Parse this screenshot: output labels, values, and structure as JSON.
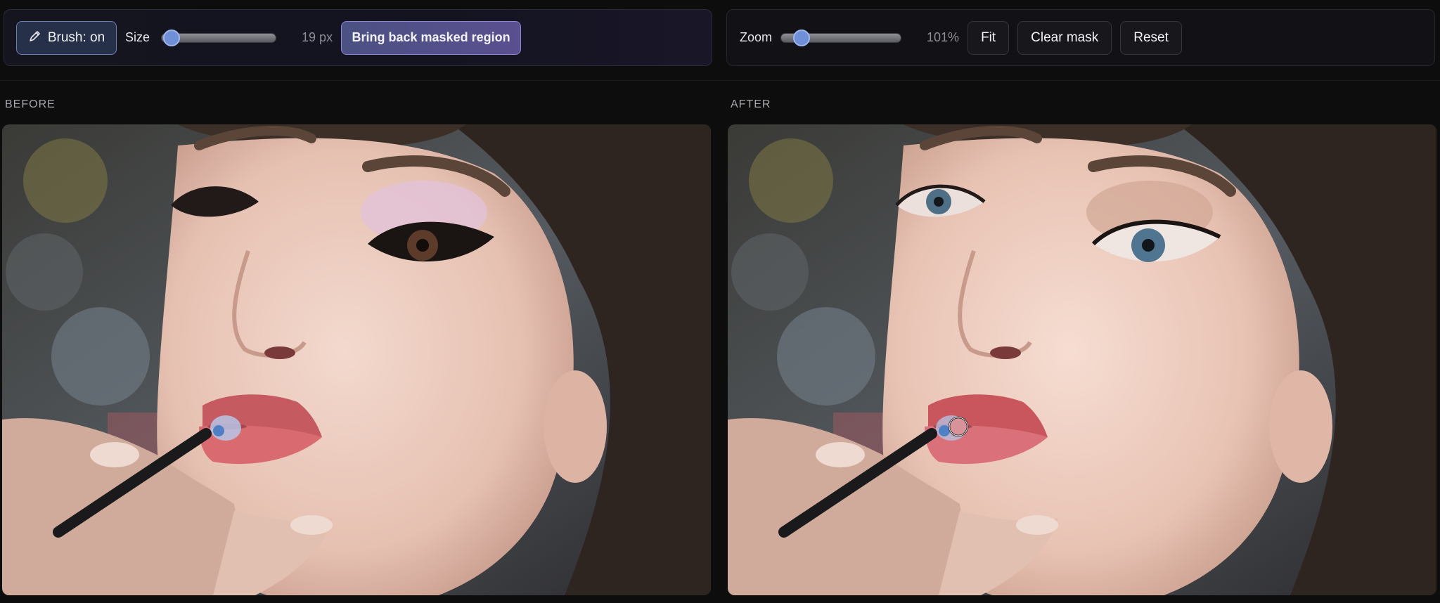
{
  "toolbar_left": {
    "brush_label": "Brush: on",
    "size_label": "Size",
    "size_value": "19 px",
    "size_level": 0.06,
    "bring_back_label": "Bring back masked region"
  },
  "toolbar_right": {
    "zoom_label": "Zoom",
    "zoom_value": "101%",
    "zoom_level": 0.17,
    "fit_label": "Fit",
    "clear_mask_label": "Clear mask",
    "reset_label": "Reset"
  },
  "panels": {
    "before_label": "BEFORE",
    "after_label": "AFTER"
  },
  "icons": {
    "brush": "pencil-icon"
  },
  "colors": {
    "accent": "#6f8fd6",
    "bring_back_bg": "#4b5183",
    "brush_bg": "#273049"
  }
}
